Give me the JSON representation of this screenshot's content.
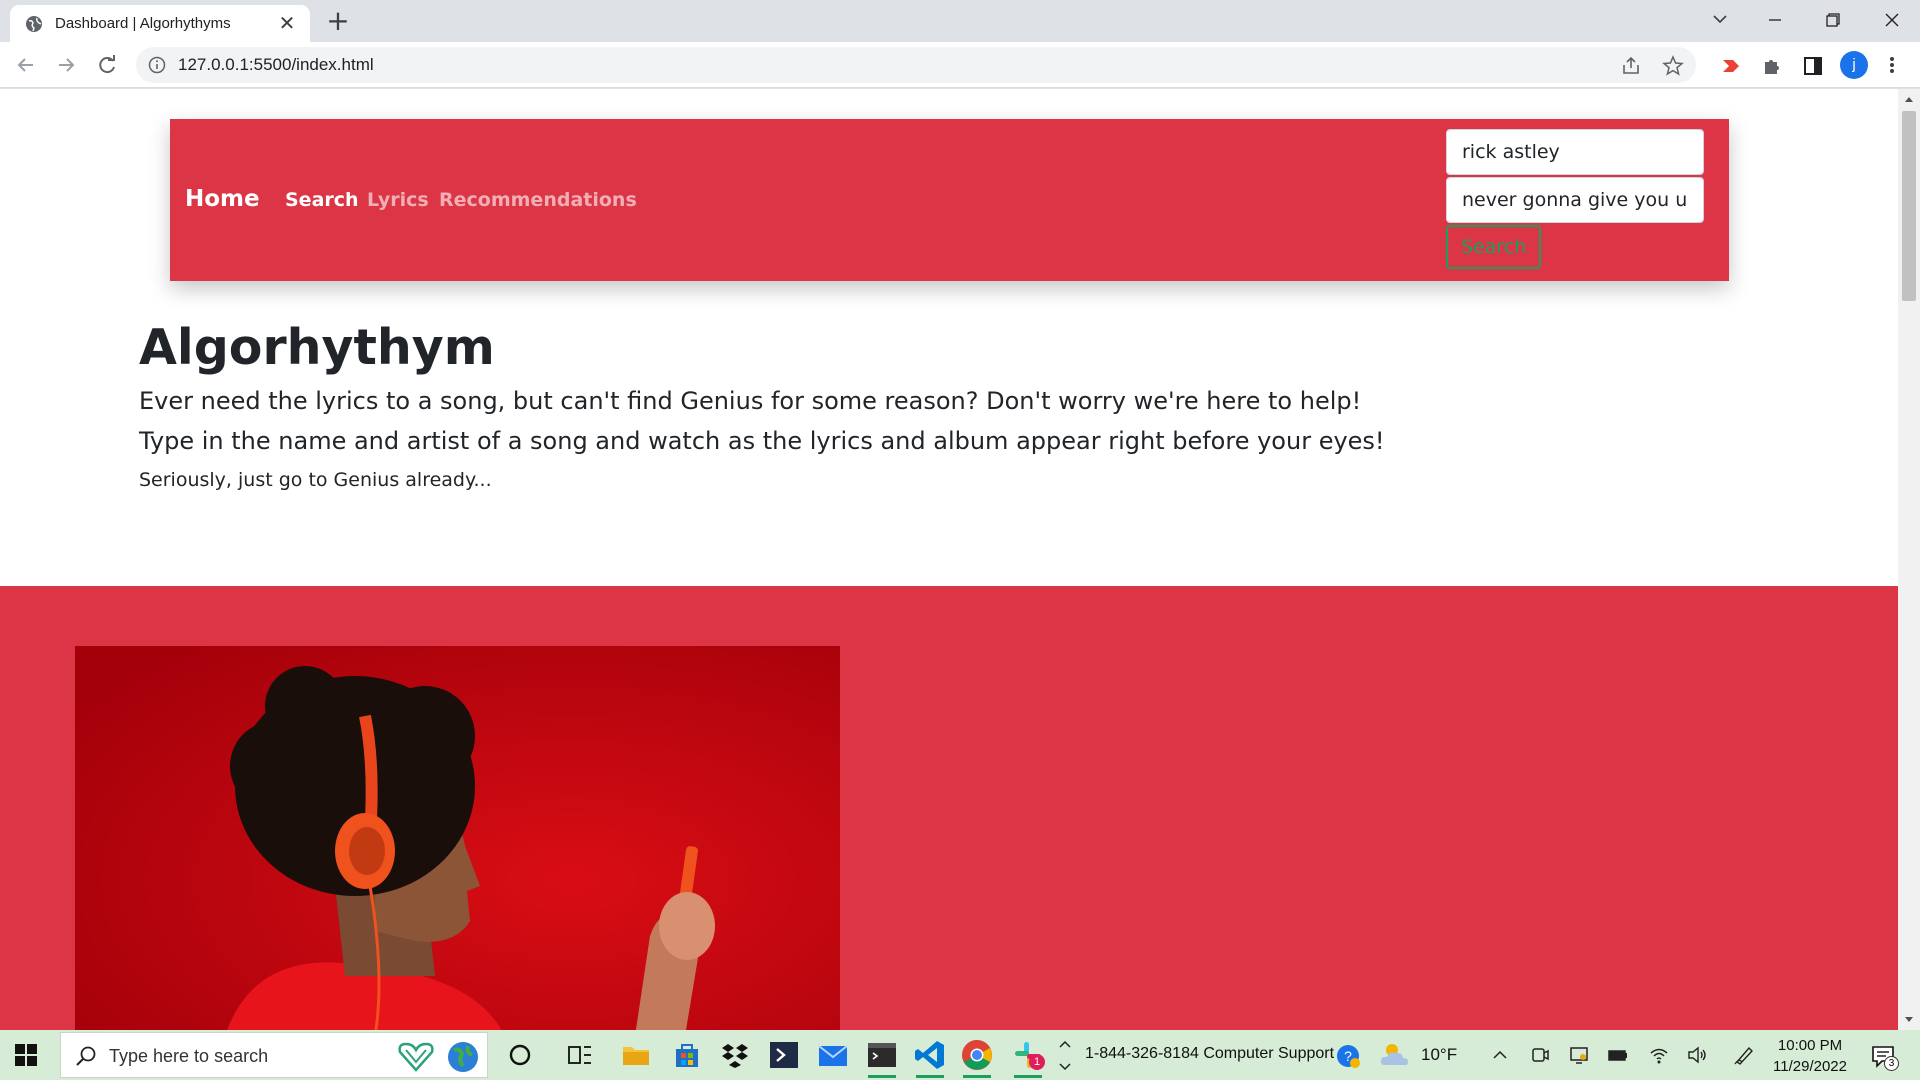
{
  "browser": {
    "tab_title": "Dashboard | Algorhythyms",
    "url": "127.0.0.1:5500/index.html",
    "profile_initial": "j"
  },
  "navbar": {
    "brand": "Home",
    "links": [
      "Search",
      "Lyrics",
      "Recommendations"
    ],
    "artist_value": "rick astley",
    "song_value": "never gonna give you up",
    "search_button": "Search"
  },
  "hero": {
    "title": "Algorhythym",
    "line1": "Ever need the lyrics to a song, but can't find Genius for some reason? Don't worry we're here to help!",
    "line2": "Type in the name and artist of a song and watch as the lyrics and album appear right before your eyes!",
    "small": "Seriously, just go to Genius already..."
  },
  "taskbar": {
    "search_placeholder": "Type here to search",
    "support_text": "1-844-326-8184 Computer Support",
    "temperature": "10°F",
    "time": "10:00 PM",
    "date": "11/29/2022",
    "notification_count": "3",
    "slack_badge": "1"
  },
  "colors": {
    "brand_red": "#dc3545",
    "button_green": "#1c9e5c",
    "taskbar_bg": "#d6ecd6"
  }
}
